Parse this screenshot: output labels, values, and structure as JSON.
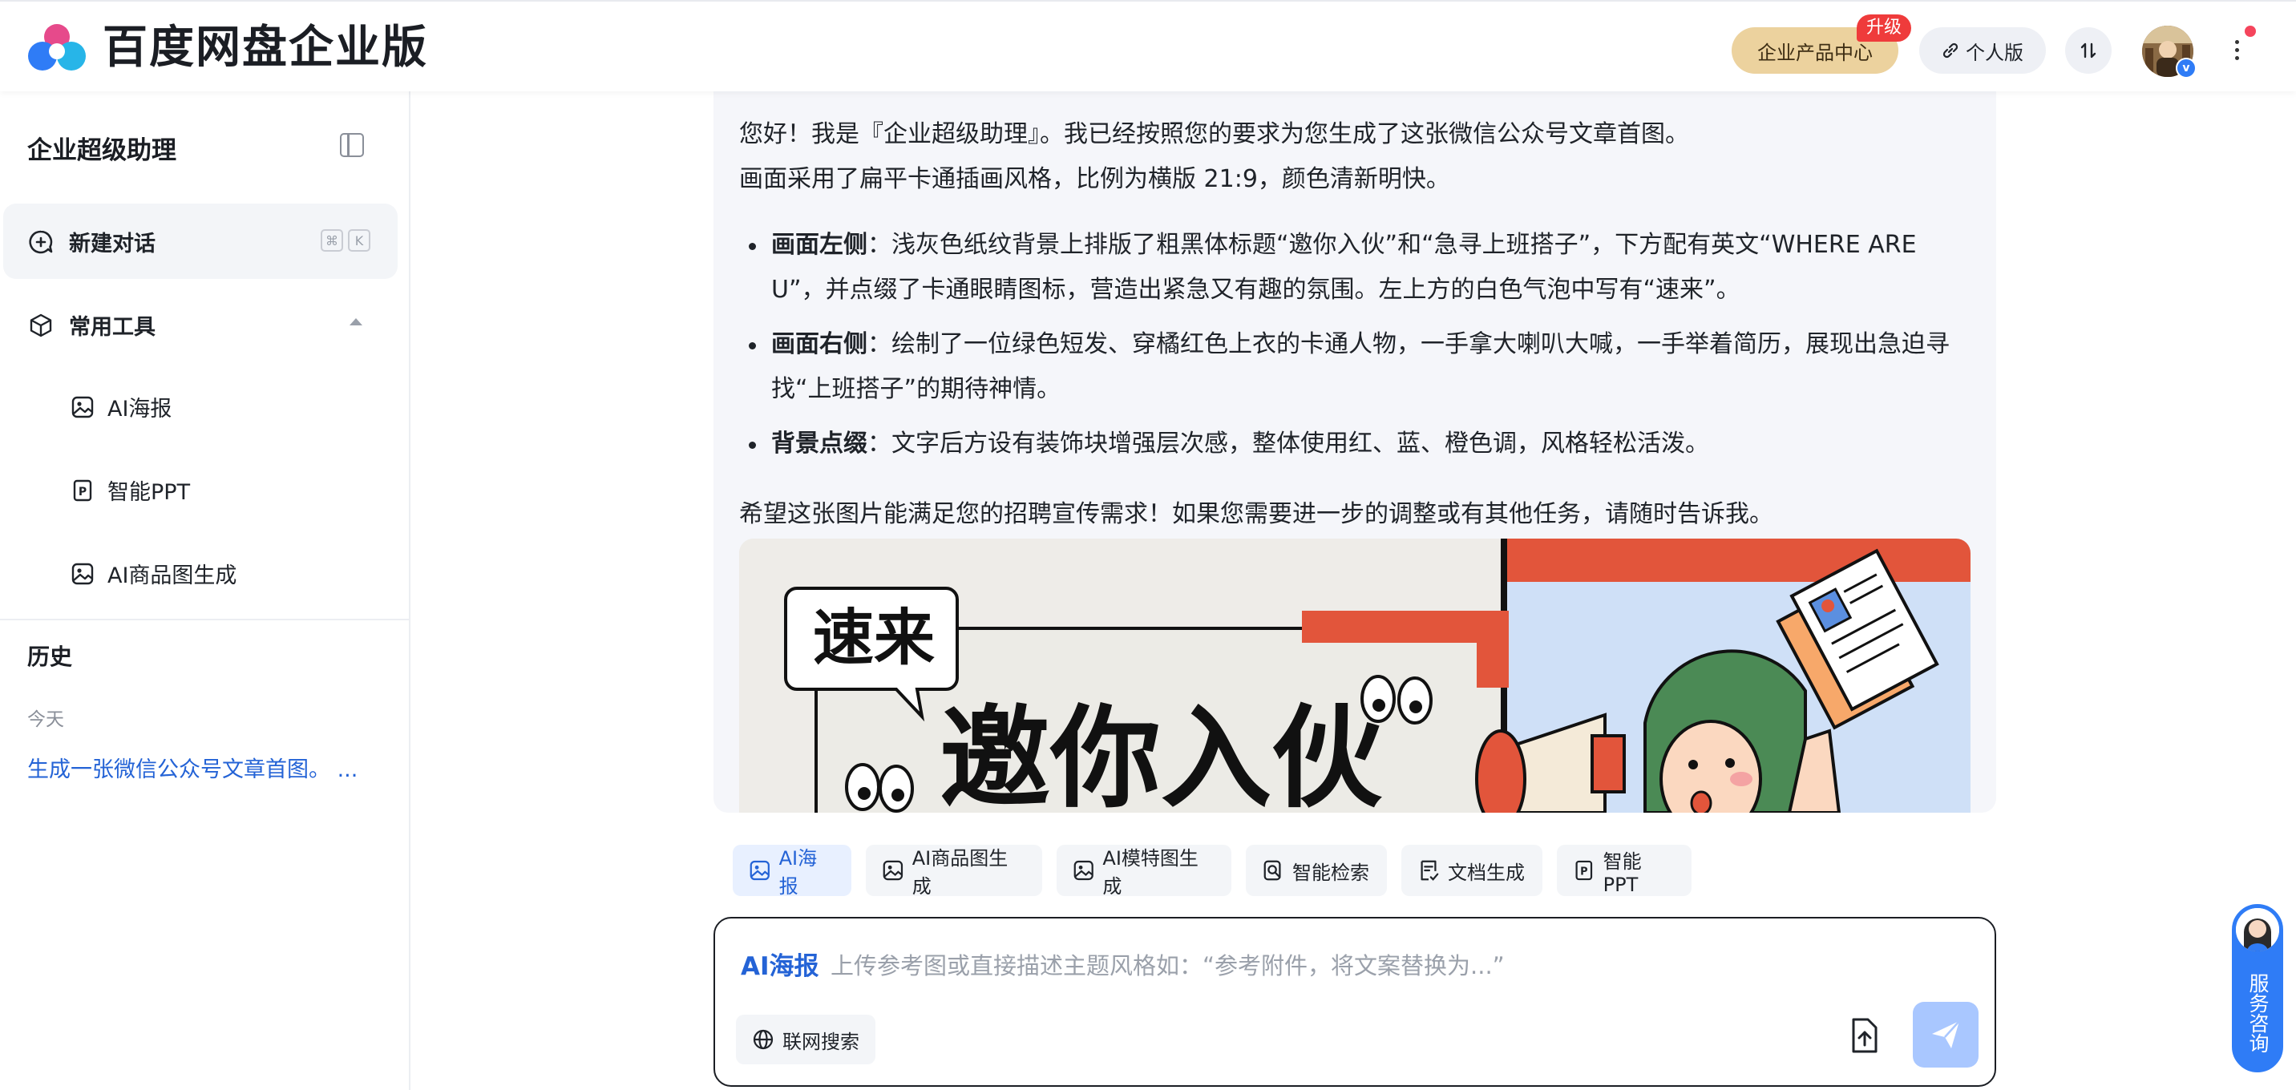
{
  "header": {
    "brand": "百度网盘企业版",
    "enterprise_center": "企业产品中心",
    "upgrade_badge": "升级",
    "personal": "个人版"
  },
  "sidebar": {
    "title": "企业超级助理",
    "new_chat": "新建对话",
    "shortcut_keys": [
      "⌘",
      "K"
    ],
    "tools_section": "常用工具",
    "tools": [
      {
        "label": "AI海报",
        "icon": "image-icon"
      },
      {
        "label": "智能PPT",
        "icon": "ppt-icon"
      },
      {
        "label": "AI商品图生成",
        "icon": "image-icon"
      }
    ],
    "history_title": "历史",
    "today": "今天",
    "history_item": "生成一张微信公众号文章首图。 ..."
  },
  "chat": {
    "intro_line1": "您好！我是『企业超级助理』。我已经按照您的要求为您生成了这张微信公众号文章首图。",
    "intro_line2": "画面采用了扁平卡通插画风格，比例为横版 21:9，颜色清新明快。",
    "bullets": [
      {
        "head": "画面左侧",
        "text": "：浅灰色纸纹背景上排版了粗黑体标题“邀你入伙”和“急寻上班搭子”，下方配有英文“WHERE ARE U”，并点缀了卡通眼睛图标，营造出紧急又有趣的氛围。左上方的白色气泡中写有“速来”。"
      },
      {
        "head": "画面右侧",
        "text": "：绘制了一位绿色短发、穿橘红色上衣的卡通人物，一手拿大喇叭大喊，一手举着简历，展现出急迫寻找“上班搭子”的期待神情。"
      },
      {
        "head": "背景点缀",
        "text": "：文字后方设有装饰块增强层次感，整体使用红、蓝、橙色调，风格轻松活泼。"
      }
    ],
    "outro": "希望这张图片能满足您的招聘宣传需求！如果您需要进一步的调整或有其他任务，请随时告诉我。",
    "image": {
      "bubble_text": "速来",
      "title_text": "邀你入伙"
    }
  },
  "quick_tools": [
    {
      "label": "AI海报",
      "active": true
    },
    {
      "label": "AI商品图生成",
      "active": false
    },
    {
      "label": "AI模特图生成",
      "active": false
    },
    {
      "label": "智能检索",
      "active": false
    },
    {
      "label": "文档生成",
      "active": false
    },
    {
      "label": "智能PPT",
      "active": false
    }
  ],
  "input": {
    "mode_tag": "AI海报",
    "placeholder": "上传参考图或直接描述主题风格如：“参考附件，将文案替换为...”",
    "web_search": "联网搜索"
  },
  "service": {
    "label": "服务咨询"
  },
  "colors": {
    "accent": "#2463d6",
    "send_disabled": "#a9c7ff",
    "enterprise_gold": "#ecd29e",
    "badge_red": "#ef3b3b"
  }
}
